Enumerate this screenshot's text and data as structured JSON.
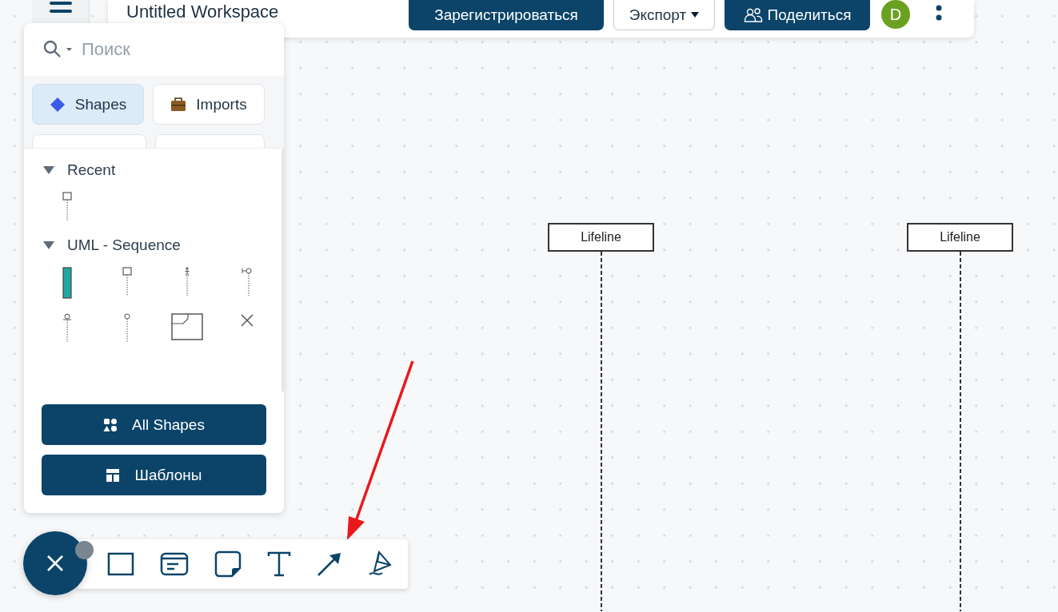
{
  "header": {
    "title": "Untitled Workspace",
    "avatar": "D",
    "buttons": [
      {
        "label": "Зарегистрироваться",
        "kind": "primary"
      },
      {
        "label": "Экспорт",
        "kind": "dropdown"
      },
      {
        "label": "Поделиться",
        "kind": "share"
      }
    ]
  },
  "panel": {
    "search": {
      "placeholder": "Поиск"
    },
    "tabs": [
      {
        "label": "Shapes",
        "kind": "shapes",
        "selected": true
      },
      {
        "label": "Imports",
        "kind": "imports",
        "selected": false
      }
    ],
    "sections": [
      {
        "title": "Recent",
        "expanded": true,
        "shapes": [
          {
            "kind": "lifeline"
          }
        ]
      },
      {
        "title": "UML - Sequence",
        "expanded": true,
        "shapes": [
          {
            "kind": "activation"
          },
          {
            "kind": "lifeline"
          },
          {
            "kind": "actor"
          },
          {
            "kind": "boundary"
          },
          {
            "kind": "entity"
          },
          {
            "kind": "control"
          },
          {
            "kind": "frame"
          },
          {
            "kind": "destroy"
          }
        ]
      }
    ],
    "buttons": [
      {
        "label": "All Shapes",
        "kind": "all"
      },
      {
        "label": "Шаблоны",
        "kind": "templates"
      }
    ]
  },
  "canvas": {
    "lifelines": [
      {
        "label": "Lifeline"
      },
      {
        "label": "Lifeline"
      }
    ]
  },
  "toolbar": {
    "tools": [
      {
        "kind": "rectangle"
      },
      {
        "kind": "card"
      },
      {
        "kind": "note"
      },
      {
        "kind": "text"
      },
      {
        "kind": "arrow"
      },
      {
        "kind": "pen"
      }
    ]
  }
}
